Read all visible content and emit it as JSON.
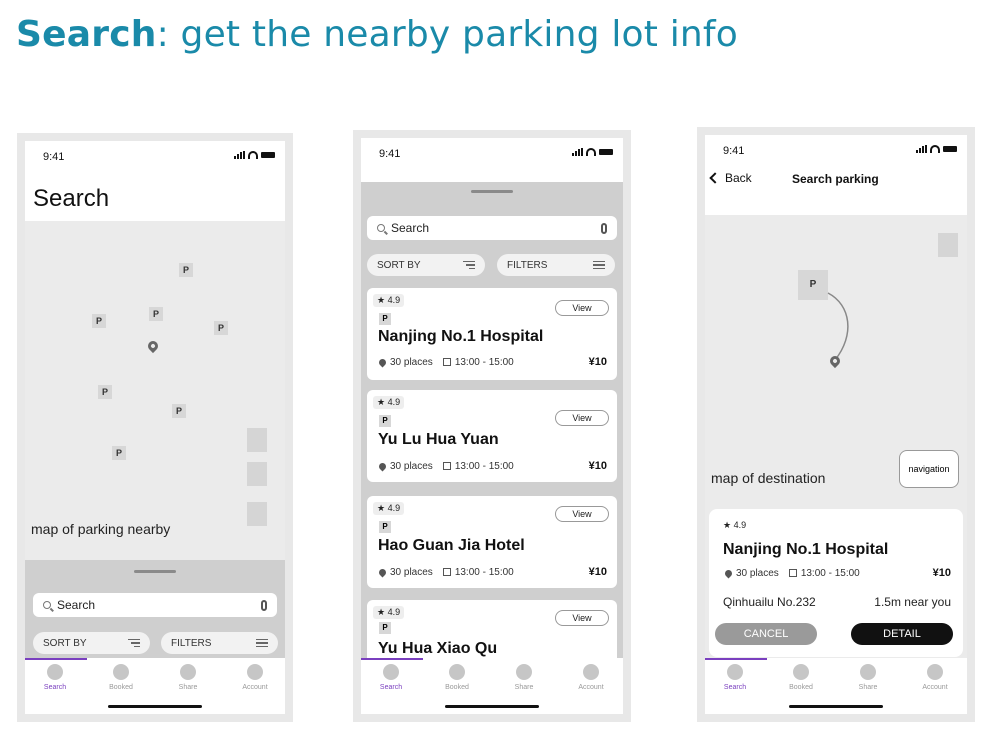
{
  "page": {
    "title_bold": "Search",
    "title_rest": ": get the nearby parking lot info"
  },
  "status": {
    "time": "9:41"
  },
  "tabs": [
    "Search",
    "Booked",
    "Share",
    "Account"
  ],
  "screen1": {
    "heading": "Search",
    "map_label": "map of parking nearby",
    "marker_label": "P",
    "search_placeholder": "Search",
    "sort_label": "SORT BY",
    "filter_label": "FILTERS"
  },
  "screen2": {
    "search_placeholder": "Search",
    "sort_label": "SORT BY",
    "filter_label": "FILTERS",
    "cards": [
      {
        "rating": "4.9",
        "p": "P",
        "view": "View",
        "name": "Nanjing No.1 Hospital",
        "places": "30 places",
        "time": "13:00 - 15:00",
        "price": "¥10"
      },
      {
        "rating": "4.9",
        "p": "P",
        "view": "View",
        "name": "Yu Lu Hua Yuan",
        "places": "30 places",
        "time": "13:00 - 15:00",
        "price": "¥10"
      },
      {
        "rating": "4.9",
        "p": "P",
        "view": "View",
        "name": "Hao Guan Jia Hotel",
        "places": "30 places",
        "time": "13:00 - 15:00",
        "price": "¥10"
      },
      {
        "rating": "4.9",
        "p": "P",
        "view": "View",
        "name": "Yu Hua Xiao Qu",
        "places": "",
        "time": "",
        "price": ""
      }
    ]
  },
  "screen3": {
    "back": "Back",
    "title": "Search parking",
    "marker_label": "P",
    "map_label": "map of destination",
    "navigation": "navigation",
    "card": {
      "rating": "4.9",
      "name": "Nanjing No.1 Hospital",
      "places": "30 places",
      "time": "13:00 - 15:00",
      "price": "¥10",
      "address": "Qinhuailu No.232",
      "distance": "1.5m near you"
    },
    "cancel": "CANCEL",
    "detail": "DETAIL"
  }
}
